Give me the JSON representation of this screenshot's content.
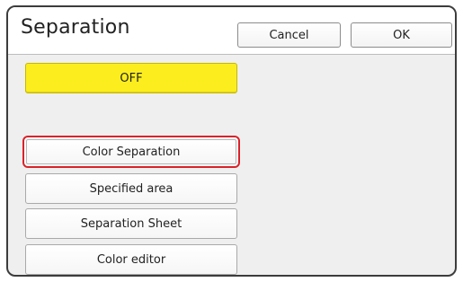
{
  "dialog": {
    "title": "Separation",
    "cancel_label": "Cancel",
    "ok_label": "OK"
  },
  "options": {
    "off_label": "OFF",
    "color_separation_label": "Color Separation",
    "specified_area_label": "Specified area",
    "separation_sheet_label": "Separation Sheet",
    "color_editor_label": "Color editor"
  },
  "colors": {
    "selected_option": "#fcee1e",
    "highlight_outline": "#d9222a",
    "panel_background": "#efefef"
  }
}
